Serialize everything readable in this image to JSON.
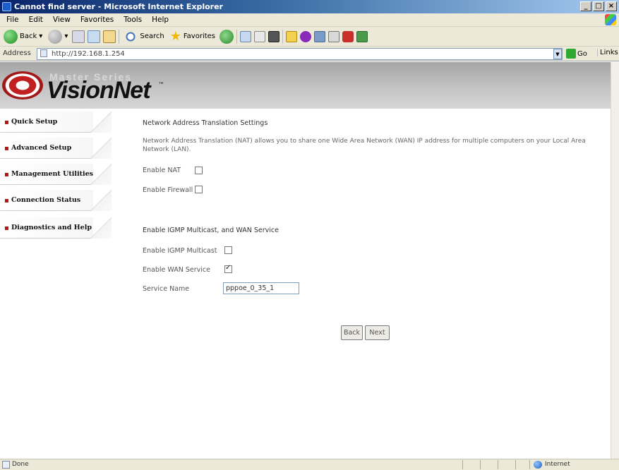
{
  "window": {
    "title": "Cannot find server - Microsoft Internet Explorer",
    "controls": {
      "minimize": "_",
      "maximize": "□",
      "close": "×"
    }
  },
  "menubar": {
    "items": [
      {
        "label": "File"
      },
      {
        "label": "Edit"
      },
      {
        "label": "View"
      },
      {
        "label": "Favorites"
      },
      {
        "label": "Tools"
      },
      {
        "label": "Help"
      }
    ]
  },
  "toolbar": {
    "back_label": "Back",
    "search_label": "Search",
    "favorites_label": "Favorites"
  },
  "addressbar": {
    "label": "Address",
    "url": "http://192.168.1.254",
    "go_label": "Go",
    "links_label": "Links"
  },
  "banner": {
    "series_text": "Master Series",
    "brand": "VisionNet",
    "trademark": "™"
  },
  "sidebar": {
    "items": [
      {
        "label": "Quick Setup"
      },
      {
        "label": "Advanced Setup"
      },
      {
        "label": "Management Utilities"
      },
      {
        "label": "Connection Status"
      },
      {
        "label": "Diagnostics and Help"
      }
    ],
    "bullet": "▪"
  },
  "main": {
    "nat_title": "Network Address Translation Settings",
    "nat_description": "Network Address Translation (NAT) allows you to share one Wide Area Network (WAN) IP address for multiple computers on your Local Area Network (LAN).",
    "enable_nat_label": "Enable NAT",
    "enable_nat_checked": false,
    "enable_firewall_label": "Enable Firewall",
    "enable_firewall_checked": false,
    "igmp_title": "Enable IGMP Multicast, and WAN Service",
    "enable_igmp_label": "Enable IGMP Multicast",
    "enable_igmp_checked": false,
    "enable_wan_label": "Enable WAN Service",
    "enable_wan_checked": true,
    "service_name_label": "Service Name",
    "service_name_value": "pppoe_0_35_1",
    "back_button": "Back",
    "next_button": "Next"
  },
  "statusbar": {
    "status_text": "Done",
    "zone_text": "Internet"
  }
}
